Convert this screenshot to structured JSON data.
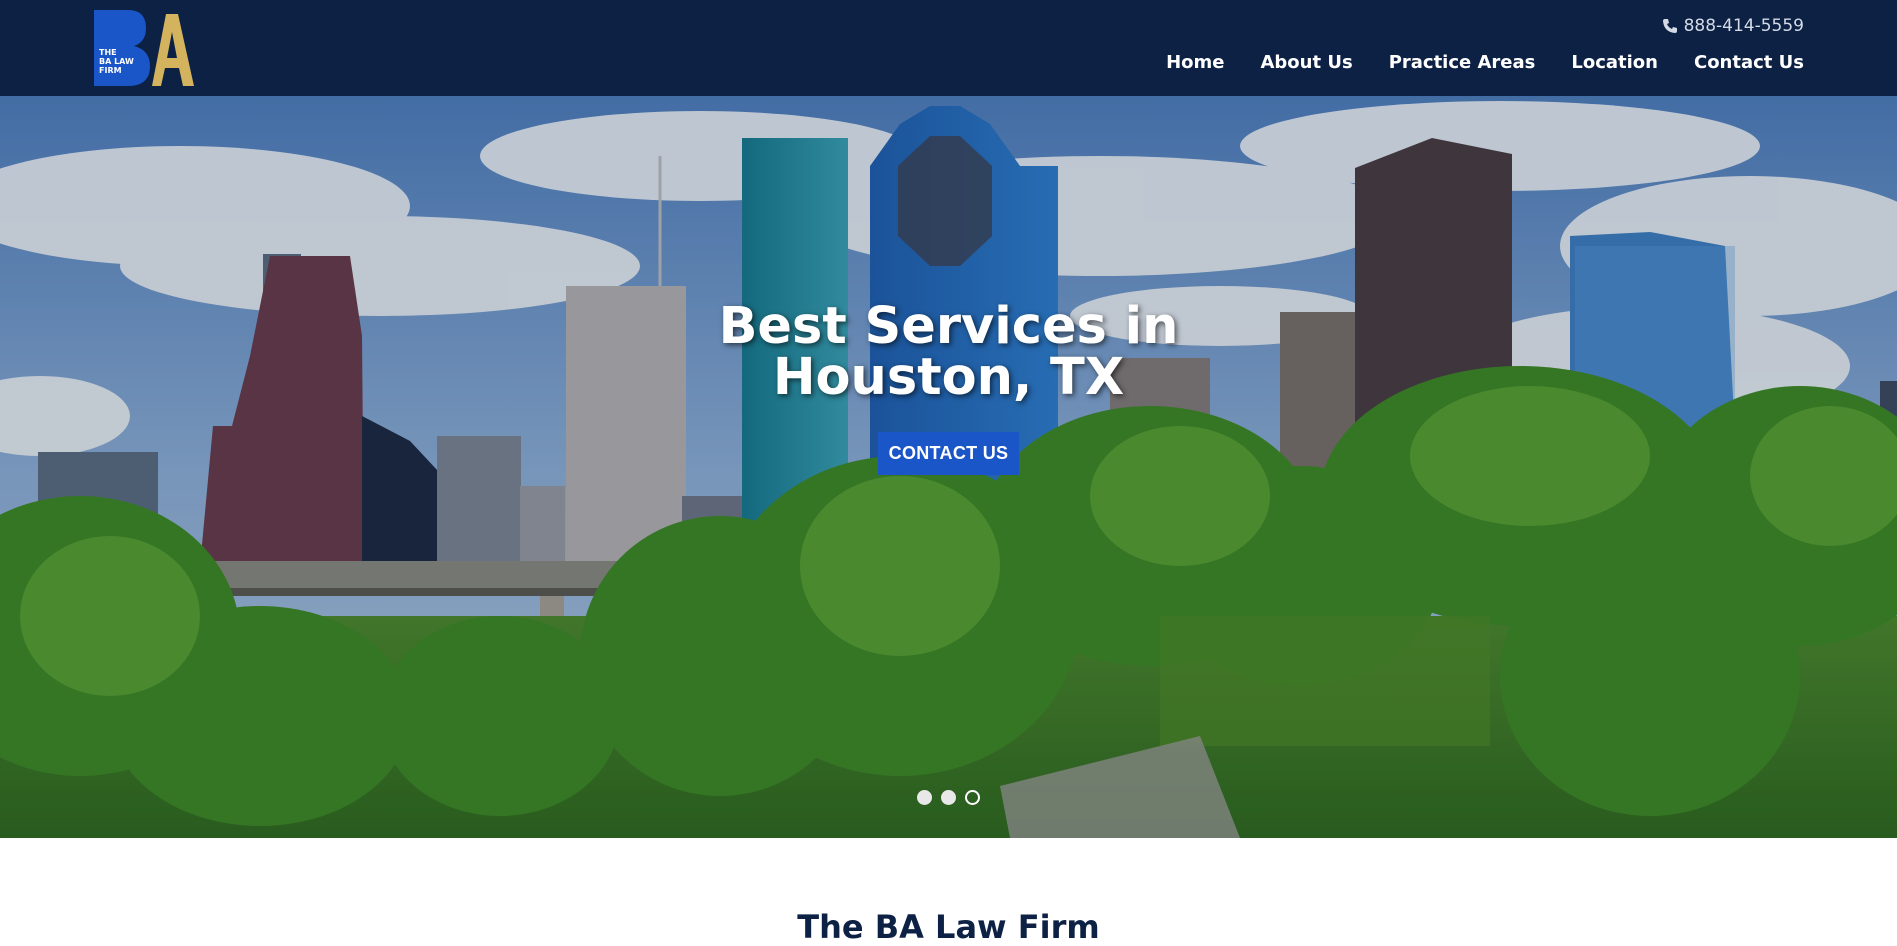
{
  "header": {
    "logo_text_lines": [
      "THE",
      "BA LAW",
      "FIRM"
    ],
    "logo_letters": "BA",
    "phone": "888-414-5559",
    "nav": [
      {
        "label": "Home"
      },
      {
        "label": "About Us"
      },
      {
        "label": "Practice Areas"
      },
      {
        "label": "Location"
      },
      {
        "label": "Contact Us"
      }
    ]
  },
  "hero": {
    "title_line1": "Best Services in",
    "title_line2": "Houston, TX",
    "cta_label": "CONTACT US",
    "slides": 3,
    "active_slide": 3
  },
  "section": {
    "title": "The BA Law Firm"
  },
  "colors": {
    "header_bg": "#0c2144",
    "cta_bg": "#1a56c7",
    "logo_blue": "#1a56c7",
    "logo_gold": "#d4b35e"
  }
}
